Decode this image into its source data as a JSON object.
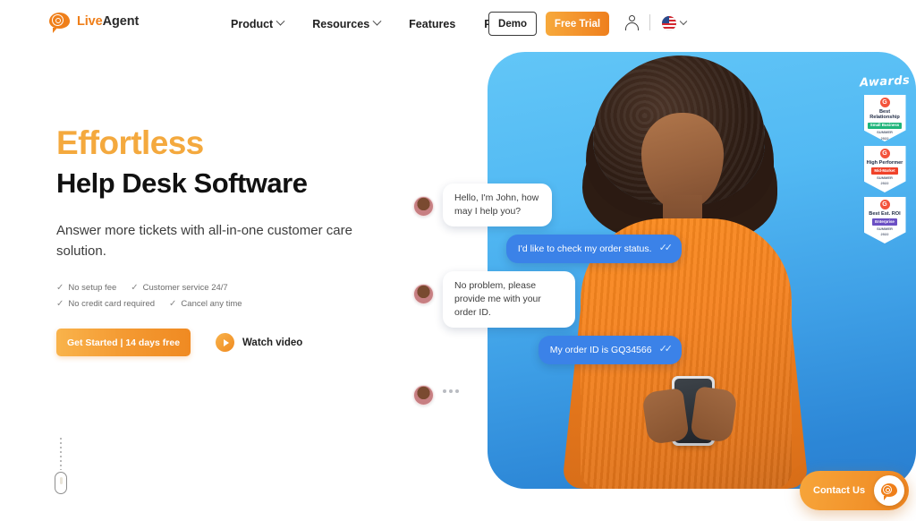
{
  "header": {
    "logo": {
      "brand_first": "Live",
      "brand_second": "Agent",
      "icon": "at-speech-bubble-icon"
    },
    "nav": [
      {
        "label": "Product",
        "has_dropdown": true
      },
      {
        "label": "Resources",
        "has_dropdown": true
      },
      {
        "label": "Features",
        "has_dropdown": false
      },
      {
        "label": "Pricing",
        "has_dropdown": false
      }
    ],
    "demo_button": "Demo",
    "trial_button": "Free Trial",
    "account_icon": "user-icon",
    "language": {
      "flag": "us-flag-icon",
      "chevron": "chevron-down-icon"
    }
  },
  "hero": {
    "headline_accent": "Effortless",
    "headline_main": "Help Desk Software",
    "subheadline": "Answer more tickets with all-in-one customer care solution.",
    "checks": [
      "No setup fee",
      "Customer service 24/7",
      "No credit card required",
      "Cancel any time"
    ],
    "check_mark": "✓",
    "cta_primary": "Get Started | 14 days free",
    "cta_secondary": "Watch video",
    "play_icon": "play-icon",
    "scroll_indicator": "scroll-mouse-icon"
  },
  "chat": {
    "messages": [
      {
        "side": "in",
        "text": "Hello, I'm John, how may I help you?",
        "avatar": true
      },
      {
        "side": "out",
        "text": "I'd like to check my order status.",
        "ticks": "✓✓"
      },
      {
        "side": "in",
        "text": "No problem, please provide me with your order ID.",
        "avatar": true
      },
      {
        "side": "out",
        "text": "My order ID is GQ34566",
        "ticks": "✓✓"
      },
      {
        "side": "typing",
        "text": "",
        "avatar": true
      }
    ]
  },
  "awards": {
    "title": "Awards",
    "badges": [
      {
        "g2": "G",
        "title": "Best Relationship",
        "category": "Small Business",
        "category_color": "#1FB57A",
        "season": "SUMMER",
        "year": "2022"
      },
      {
        "g2": "G",
        "title": "High Performer",
        "category": "Mid-Market",
        "category_color": "#F0422A",
        "season": "SUMMER",
        "year": "2022"
      },
      {
        "g2": "G",
        "title": "Best Est. ROI",
        "category": "Enterprise",
        "category_color": "#6B4FC4",
        "season": "SUMMER",
        "year": "2022"
      }
    ]
  },
  "contact_widget": {
    "label": "Contact Us",
    "icon": "at-speech-bubble-icon"
  },
  "colors": {
    "accent_orange": "#EF7F1A",
    "accent_amber": "#F4A93E",
    "chat_blue": "#3B82E8",
    "panel_blue_top": "#62C6F7",
    "panel_blue_bottom": "#2A7FD0",
    "text_dark": "#111111"
  }
}
